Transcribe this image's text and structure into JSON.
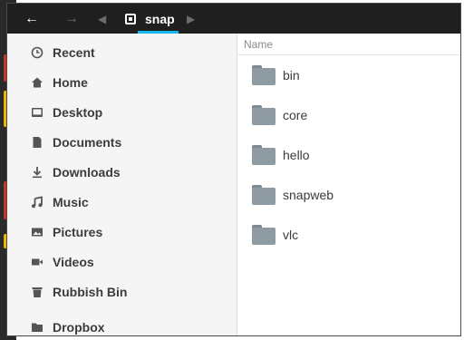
{
  "headerbar": {
    "back_icon": "arrow-left-icon",
    "forward_icon": "arrow-right-icon",
    "crumb_prev_icon": "chevron-left-icon",
    "crumb_next_icon": "chevron-right-icon",
    "location_icon": "drive-icon",
    "location_label": "snap",
    "accent_color": "#19b6ee"
  },
  "sidebar": {
    "items": [
      {
        "label": "Recent",
        "icon": "clock-icon"
      },
      {
        "label": "Home",
        "icon": "home-icon"
      },
      {
        "label": "Desktop",
        "icon": "desktop-icon"
      },
      {
        "label": "Documents",
        "icon": "document-icon"
      },
      {
        "label": "Downloads",
        "icon": "download-icon"
      },
      {
        "label": "Music",
        "icon": "music-icon"
      },
      {
        "label": "Pictures",
        "icon": "pictures-icon"
      },
      {
        "label": "Videos",
        "icon": "video-icon"
      },
      {
        "label": "Rubbish Bin",
        "icon": "trash-icon"
      },
      {
        "label": "Dropbox",
        "icon": "folder-icon"
      }
    ]
  },
  "files": {
    "column_header": "Name",
    "items": [
      {
        "name": "bin"
      },
      {
        "name": "core"
      },
      {
        "name": "hello"
      },
      {
        "name": "snapweb"
      },
      {
        "name": "vlc"
      }
    ]
  }
}
